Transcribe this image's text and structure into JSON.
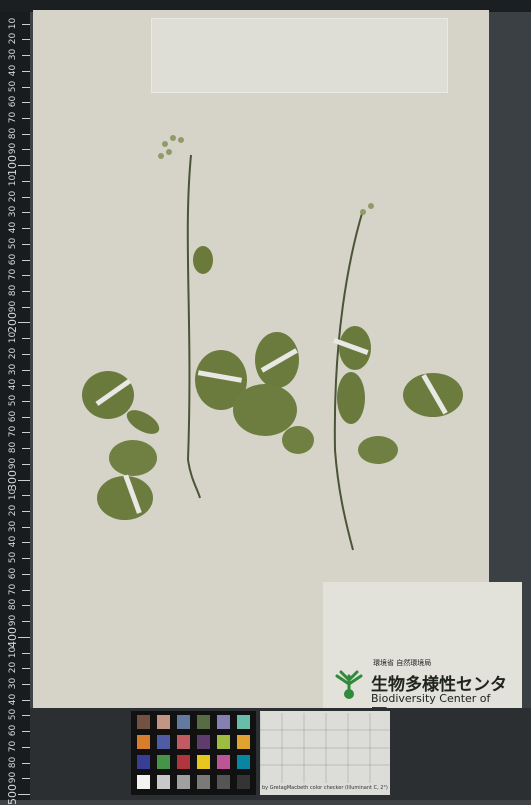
{
  "ruler": {
    "labels": [
      "0",
      "10",
      "20",
      "30",
      "40",
      "50",
      "60",
      "70",
      "80",
      "90",
      "100",
      "10",
      "20",
      "30",
      "40",
      "50",
      "60",
      "70",
      "80",
      "90",
      "200",
      "10",
      "20",
      "30",
      "40",
      "50",
      "60",
      "70",
      "80",
      "90",
      "300",
      "10",
      "20",
      "30",
      "40",
      "50",
      "60",
      "70",
      "80",
      "90",
      "400",
      "10",
      "20",
      "30",
      "40",
      "50",
      "60",
      "70",
      "80",
      "90",
      "500"
    ]
  },
  "label": {
    "ministry": "環境省 自然環境局",
    "center_jp": "生物多様性センター",
    "center_en": "Biodiversity Center of Japan"
  },
  "color_chart": {
    "caption": "by GretagMacbeth color checker (Illuminant C, 2°)"
  }
}
